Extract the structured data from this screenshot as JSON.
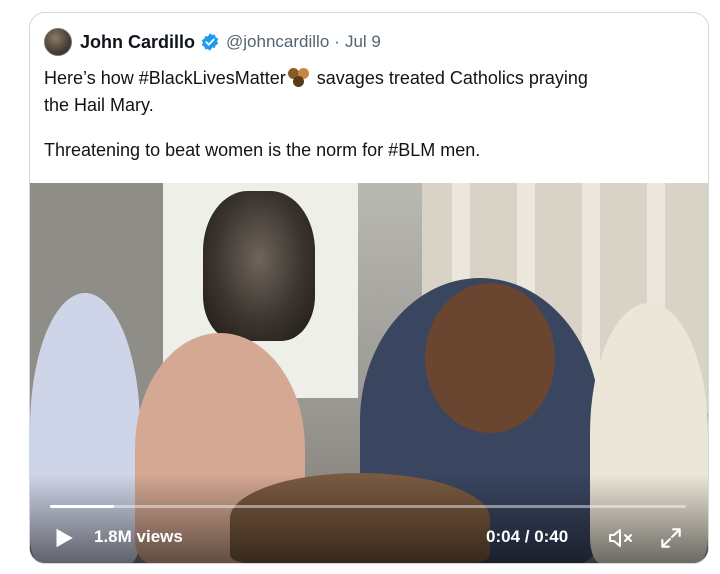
{
  "tweet": {
    "author_name": "John Cardillo",
    "handle": "@johncardillo",
    "separator": "·",
    "date": "Jul 9",
    "text_line1_a": "Here’s how #BlackLivesMatter",
    "text_line1_b": " savages treated Catholics praying",
    "text_line2": "the Hail Mary.",
    "text_line3": "Threatening to beat women is the norm for #BLM men.",
    "emoji": "three-dots-emoji"
  },
  "video": {
    "views": "1.8M views",
    "time": "0:04 / 0:40",
    "progress": 0.1,
    "icons": [
      "play-icon",
      "mute-icon",
      "expand-icon"
    ]
  },
  "colors": {
    "verified": "#1d9bf0",
    "text": "#0f1419",
    "muted": "#536471",
    "border": "#cfd9de"
  }
}
